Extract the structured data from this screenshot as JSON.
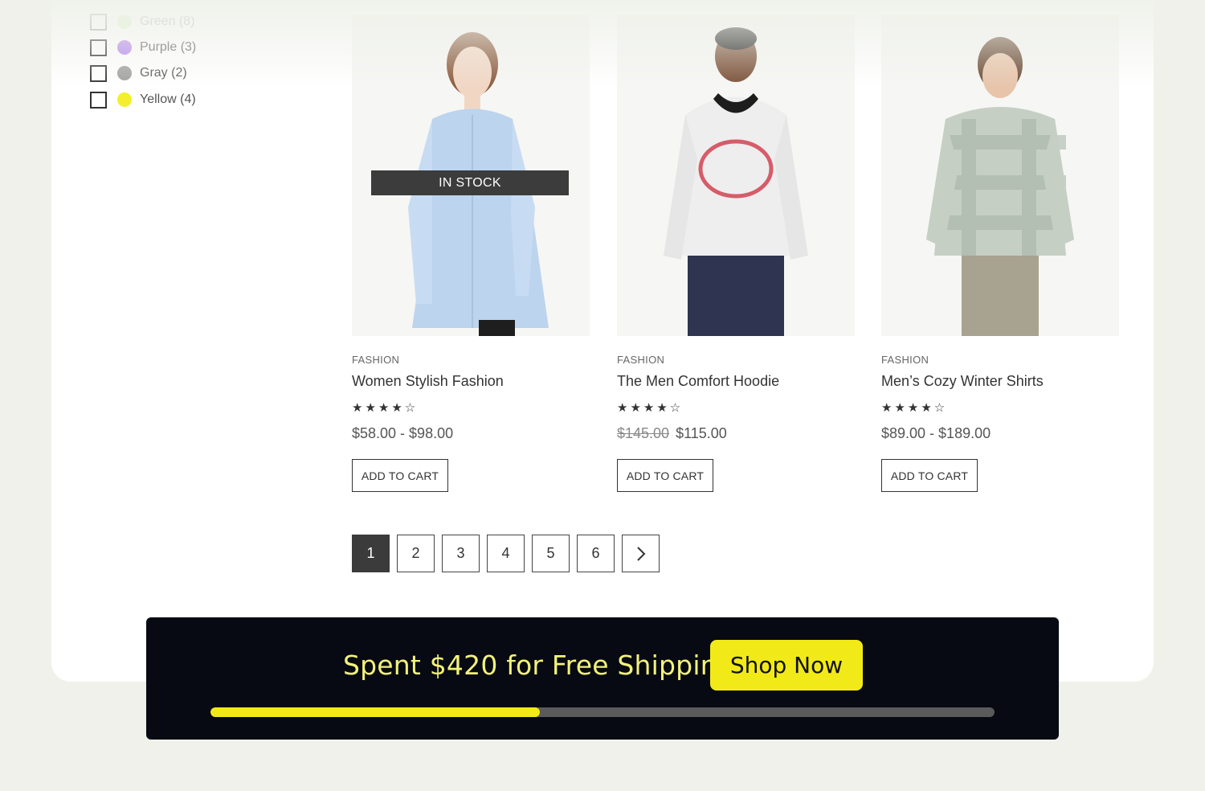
{
  "filters": {
    "colors": [
      {
        "label": "Green (8)",
        "color": "#b7ea9a",
        "faded": true
      },
      {
        "label": "Purple (3)",
        "color": "#b381ef",
        "faded": false
      },
      {
        "label": "Gray (2)",
        "color": "#a0a0a0",
        "faded": false
      },
      {
        "label": "Yellow (4)",
        "color": "#f3ef2c",
        "faded": false
      }
    ]
  },
  "products": [
    {
      "category": "FASHION",
      "title": "Women Stylish Fashion",
      "rating": 4,
      "stars": "★★★★☆",
      "price": "$58.00 - $98.00",
      "old_price": "",
      "badge": "IN STOCK",
      "cart_label": "ADD TO CART"
    },
    {
      "category": "FASHION",
      "title": "The Men Comfort Hoodie",
      "rating": 4,
      "stars": "★★★★☆",
      "price": "$115.00",
      "old_price": "$145.00",
      "badge": "",
      "cart_label": "ADD TO CART"
    },
    {
      "category": "FASHION",
      "title": "Men’s Cozy Winter Shirts",
      "rating": 4,
      "stars": "★★★★☆",
      "price": "$89.00 - $189.00",
      "old_price": "",
      "badge": "",
      "cart_label": "ADD TO CART"
    }
  ],
  "pagination": {
    "pages": [
      "1",
      "2",
      "3",
      "4",
      "5",
      "6"
    ],
    "active": "1",
    "next_icon": "chevron-right-icon"
  },
  "banner": {
    "text": "Spent $420 for Free Shipping",
    "button": "Shop Now",
    "progress": 0.42,
    "accent": "#f2ea18"
  }
}
